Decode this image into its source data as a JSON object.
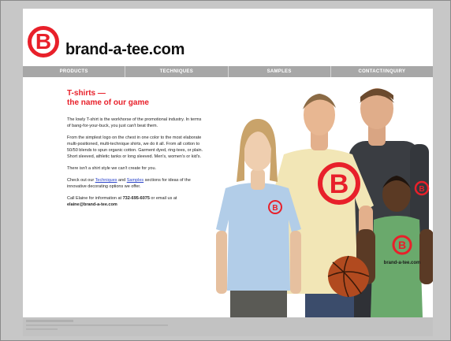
{
  "brand": {
    "logo_letter": "B",
    "name": "brand-a-tee.com"
  },
  "nav": {
    "items": [
      {
        "label": "PRODUCTS"
      },
      {
        "label": "TECHNIQUES"
      },
      {
        "label": "SAMPLES"
      },
      {
        "label": "CONTACT/INQUIRY"
      }
    ]
  },
  "main": {
    "headline_line1": "T-shirts —",
    "headline_line2": "the name of our game",
    "p1": "The lowly T-shirt is the workhorse of the promotional industry. In terms of bang-for-your-buck, you just can't beat them.",
    "p2": "From the simplest logo on the chest in one color to the most elaborate multi-positioned, multi-technique shirts, we do it all. From all cotton to 50/50 blends to spun organic cotton. Garment dyed, ring-tees, or plain. Short sleeved, athletic tanks or long sleeved. Men's, women's or kid's.",
    "p3": "There isn't a shirt style we can't create for you.",
    "p4_before": "Check out our ",
    "p4_link1": "Techniques",
    "p4_middle": " and ",
    "p4_link2": "Samples",
    "p4_after": " sections for ideas of the innovative decorating options we offer.",
    "p5_before": "Call Elaine for information at ",
    "p5_phone": "732-695-6075",
    "p5_middle": " or email us at ",
    "p5_email": "elaine@brand-a-tee.com"
  },
  "photo": {
    "shirt_logo_letter": "B",
    "shirt_logo_text": "brand-a-tee.com"
  },
  "colors": {
    "brand_red": "#e8202a",
    "nav_gray": "#a7a7a7",
    "link_blue": "#2a43c9"
  }
}
